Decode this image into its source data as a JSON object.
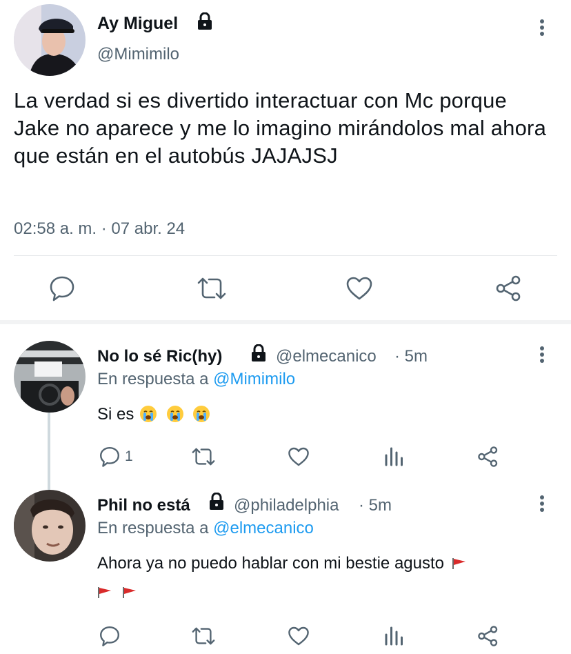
{
  "main_tweet": {
    "author_name": "Ay Miguel",
    "author_handle": "@Mimimilo",
    "text": "La verdad si es divertido interactuar con Mc porque Jake no aparece y me lo imagino mirándolos mal ahora que están en el autobús JAJAJSJ",
    "timestamp": "02:58 a. m. · 07 abr. 24"
  },
  "replies": [
    {
      "author_name": "No lo sé Ric(hy)",
      "author_handle": "@elmecanico",
      "time": "· 5m",
      "reply_prefix": "En respuesta a",
      "reply_to": "@Mimimilo",
      "text": "Si es",
      "reply_count": "1"
    },
    {
      "author_name": "Phil no está",
      "author_handle": "@philadelphia",
      "time": "· 5m",
      "reply_prefix": "En respuesta a",
      "reply_to": "@elmecanico",
      "text": "Ahora ya no puedo hablar con mi bestie agusto"
    }
  ],
  "icons": {
    "lock": "lock-icon",
    "more": "more-icon",
    "reply": "reply-icon",
    "retweet": "retweet-icon",
    "like": "heart-icon",
    "share": "share-icon",
    "stats": "stats-icon",
    "emoji": "loudly-crying-face-emoji",
    "flag": "red-flag-emoji"
  },
  "colors": {
    "mention": "#1d9bf0",
    "secondary_text": "#536471",
    "flag": "#d92b2b"
  }
}
